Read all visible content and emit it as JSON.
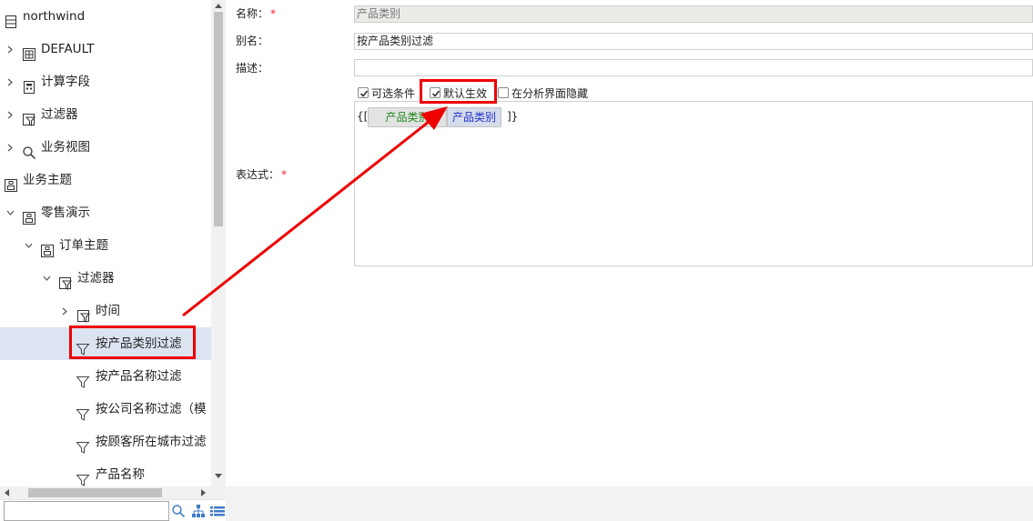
{
  "tree": {
    "items": [
      {
        "label": "northwind",
        "icon": "database-icon",
        "toggle": "none"
      },
      {
        "label": "DEFAULT",
        "icon": "table-icon",
        "toggle": "collapsed"
      },
      {
        "label": "计算字段",
        "icon": "calc-field-icon",
        "toggle": "collapsed"
      },
      {
        "label": "过滤器",
        "icon": "filter-folder-icon",
        "toggle": "collapsed"
      },
      {
        "label": "业务视图",
        "icon": "search-icon",
        "toggle": "collapsed"
      },
      {
        "label": "业务主题",
        "icon": "subject-icon",
        "toggle": "none"
      },
      {
        "label": "零售演示",
        "icon": "subject-icon",
        "toggle": "expanded"
      },
      {
        "label": "订单主题",
        "icon": "subject-icon",
        "toggle": "expanded"
      },
      {
        "label": "过滤器",
        "icon": "filter-folder-icon",
        "toggle": "expanded"
      },
      {
        "label": "时间",
        "icon": "filter-folder-icon",
        "toggle": "collapsed"
      },
      {
        "label": "按产品类别过滤",
        "icon": "filter-icon",
        "toggle": "none",
        "selected": true
      },
      {
        "label": "按产品名称过滤",
        "icon": "filter-icon",
        "toggle": "none"
      },
      {
        "label": "按公司名称过滤（模",
        "icon": "filter-icon",
        "toggle": "none"
      },
      {
        "label": "按顾客所在城市过滤",
        "icon": "filter-icon",
        "toggle": "none"
      },
      {
        "label": "产品名称",
        "icon": "filter-icon",
        "toggle": "none"
      }
    ]
  },
  "search": {
    "placeholder": "",
    "value": ""
  },
  "form": {
    "name_label": "名称：",
    "name_value": "产品类别",
    "alias_label": "别名：",
    "alias_value": "按产品类别过滤",
    "desc_label": "描述：",
    "desc_value": "",
    "expr_label": "表达式：",
    "required_mark": "*",
    "options": {
      "optional_label": "可选条件",
      "optional_checked": true,
      "default_label": "默认生效",
      "default_checked": true,
      "hide_label": "在分析界面隐藏",
      "hide_checked": false
    },
    "expression": {
      "open": "{[",
      "close": "]}",
      "tokens": [
        "产品类别",
        "产品类别"
      ]
    }
  },
  "colors": {
    "annotation": "#e00000",
    "selected_row": "#dde4f1",
    "token_green": "#1f8a1f",
    "token_blue": "#2233cc",
    "required": "#e22233"
  }
}
